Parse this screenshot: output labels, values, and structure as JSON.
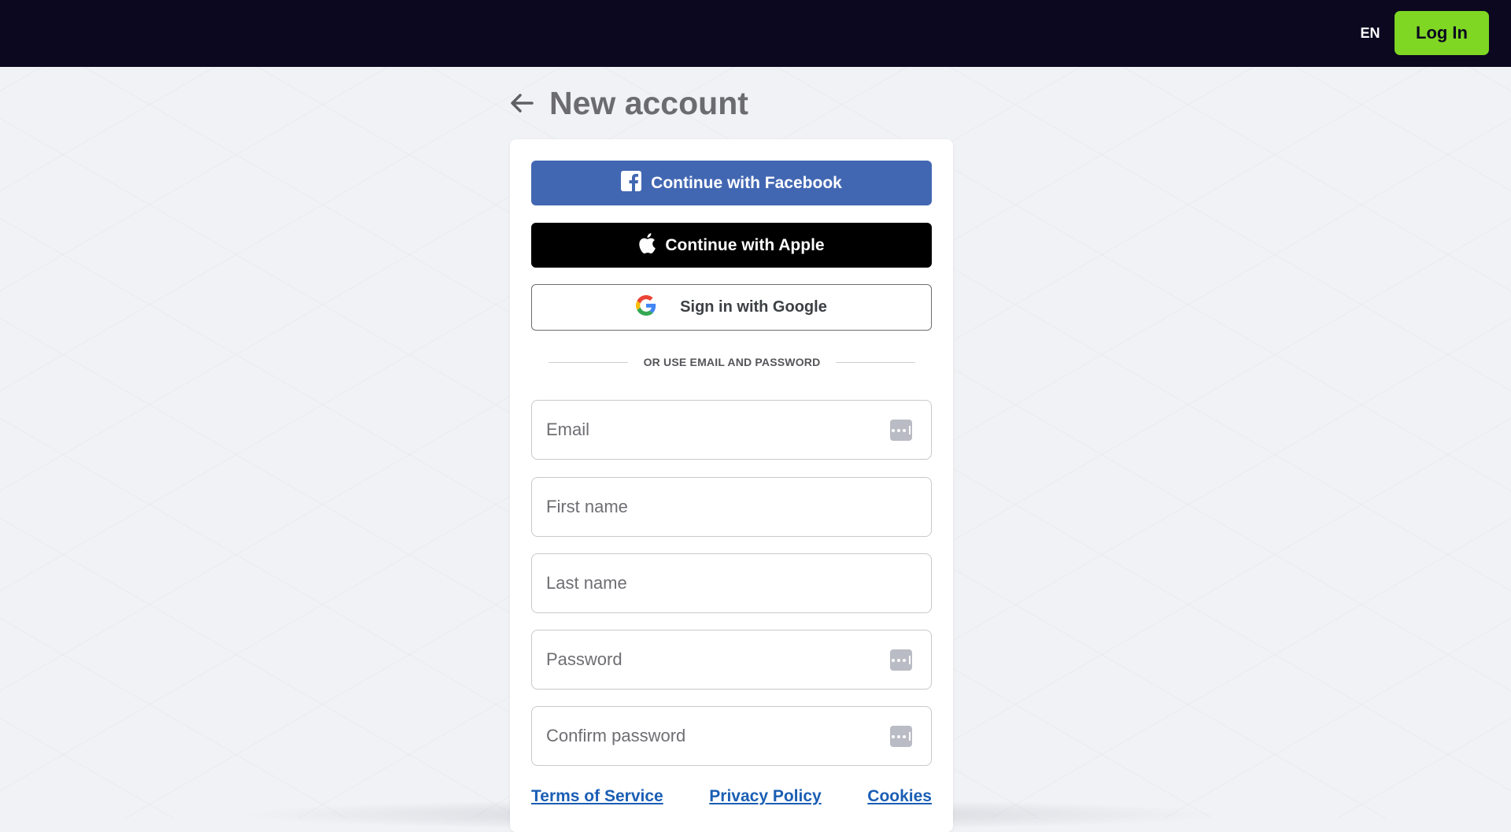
{
  "header": {
    "language": "EN",
    "login_label": "Log In"
  },
  "page": {
    "title": "New account"
  },
  "social": {
    "facebook_label": "Continue with Facebook",
    "apple_label": "Continue with Apple",
    "google_label": "Sign in with Google"
  },
  "divider": {
    "label": "OR USE EMAIL AND PASSWORD"
  },
  "form": {
    "email": {
      "placeholder": "Email",
      "value": ""
    },
    "first_name": {
      "placeholder": "First name",
      "value": ""
    },
    "last_name": {
      "placeholder": "Last name",
      "value": ""
    },
    "password": {
      "placeholder": "Password",
      "value": ""
    },
    "confirm_password": {
      "placeholder": "Confirm password",
      "value": ""
    }
  },
  "footer_links": {
    "terms": "Terms of Service",
    "privacy": "Privacy Policy",
    "cookies": "Cookies"
  },
  "colors": {
    "topbar": "#0b0820",
    "login_button": "#7fd723",
    "facebook": "#4267b2",
    "apple": "#000000",
    "link": "#1a5eb4",
    "background": "#f1f2f6"
  },
  "icons": {
    "back": "arrow-left-icon",
    "facebook": "facebook-icon",
    "apple": "apple-icon",
    "google": "google-icon",
    "password_manager": "password-manager-icon"
  }
}
